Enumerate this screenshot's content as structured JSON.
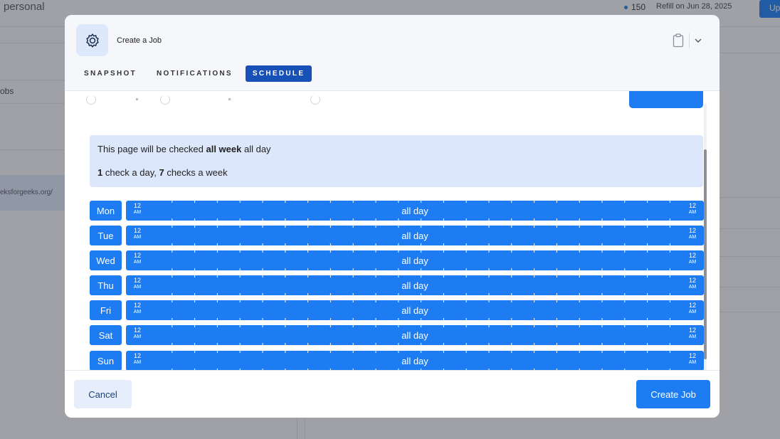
{
  "background": {
    "workspace_title": "personal",
    "credits": "150",
    "refill": "Refill on Jun 28, 2025",
    "upgrade_label": "Up",
    "nav_jobs": "obs",
    "url_fragment": "eksforgeeks.org/"
  },
  "modal": {
    "title": "Create a Job",
    "header_icon": "gear-icon",
    "tabs": [
      {
        "label": "SNAPSHOT",
        "active": false
      },
      {
        "label": "NOTIFICATIONS",
        "active": false
      },
      {
        "label": "SCHEDULE",
        "active": true
      }
    ],
    "info": {
      "line1_prefix": "This page will be checked ",
      "line1_bold": "all week",
      "line1_suffix": " all day",
      "line2_count_day": "1",
      "line2_mid": " check a day, ",
      "line2_count_week": "7",
      "line2_suffix": " checks a week"
    },
    "days": [
      {
        "day": "Mon",
        "label": "all day",
        "start_hour": "12",
        "start_period": "AM",
        "end_hour": "12",
        "end_period": "AM"
      },
      {
        "day": "Tue",
        "label": "all day",
        "start_hour": "12",
        "start_period": "AM",
        "end_hour": "12",
        "end_period": "AM"
      },
      {
        "day": "Wed",
        "label": "all day",
        "start_hour": "12",
        "start_period": "AM",
        "end_hour": "12",
        "end_period": "AM"
      },
      {
        "day": "Thu",
        "label": "all day",
        "start_hour": "12",
        "start_period": "AM",
        "end_hour": "12",
        "end_period": "AM"
      },
      {
        "day": "Fri",
        "label": "all day",
        "start_hour": "12",
        "start_period": "AM",
        "end_hour": "12",
        "end_period": "AM"
      },
      {
        "day": "Sat",
        "label": "all day",
        "start_hour": "12",
        "start_period": "AM",
        "end_hour": "12",
        "end_period": "AM"
      },
      {
        "day": "Sun",
        "label": "all day",
        "start_hour": "12",
        "start_period": "AM",
        "end_hour": "12",
        "end_period": "AM"
      }
    ],
    "footer": {
      "cancel_label": "Cancel",
      "create_label": "Create Job"
    }
  },
  "colors": {
    "accent": "#1d7cf2",
    "tab_active": "#1751b8",
    "info_bg": "#dce7fb"
  }
}
